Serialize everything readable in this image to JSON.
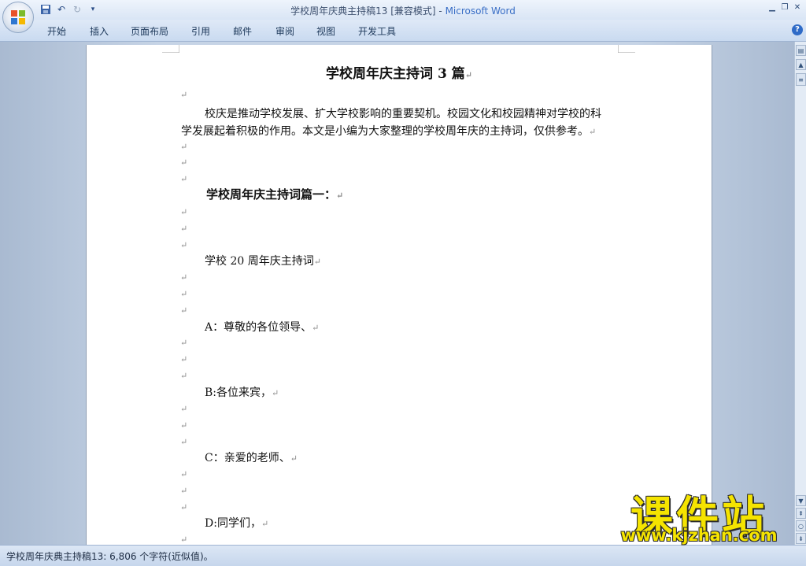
{
  "window": {
    "title": "学校周年庆典主持稿13 [兼容模式] - ",
    "app_name": "Microsoft Word"
  },
  "quick_access": {
    "icons": [
      "save-icon",
      "undo-icon",
      "redo-icon",
      "customize-icon"
    ]
  },
  "ribbon": {
    "tabs": [
      "开始",
      "插入",
      "页面布局",
      "引用",
      "邮件",
      "审阅",
      "视图",
      "开发工具"
    ],
    "help_label": "?"
  },
  "document": {
    "title": "学校周年庆主持词 3 篇",
    "intro_line1": "校庆是推动学校发展、扩大学校影响的重要契机。校园文化和校园精神对学校的科",
    "intro_line2": "学发展起着积极的作用。本文是小编为大家整理的学校周年庆的主持词，仅供参考。",
    "section_heading": "学校周年庆主持词篇一：",
    "speech_title": "学校 20 周年庆主持词",
    "line_a": "A：尊敬的各位领导、",
    "line_b": "B:各位来宾，",
    "line_c": "C：亲爱的老师、",
    "line_d": "D:同学们，",
    "paragraph_mark": "↵"
  },
  "status": {
    "text": "学校周年庆典主持稿13: 6,806 个字符(近似值)。"
  },
  "watermark": {
    "text": "课件站",
    "url": "www.kjzhan.com"
  },
  "colors": {
    "accent": "#3a6fc6",
    "watermark": "#f5e400"
  }
}
